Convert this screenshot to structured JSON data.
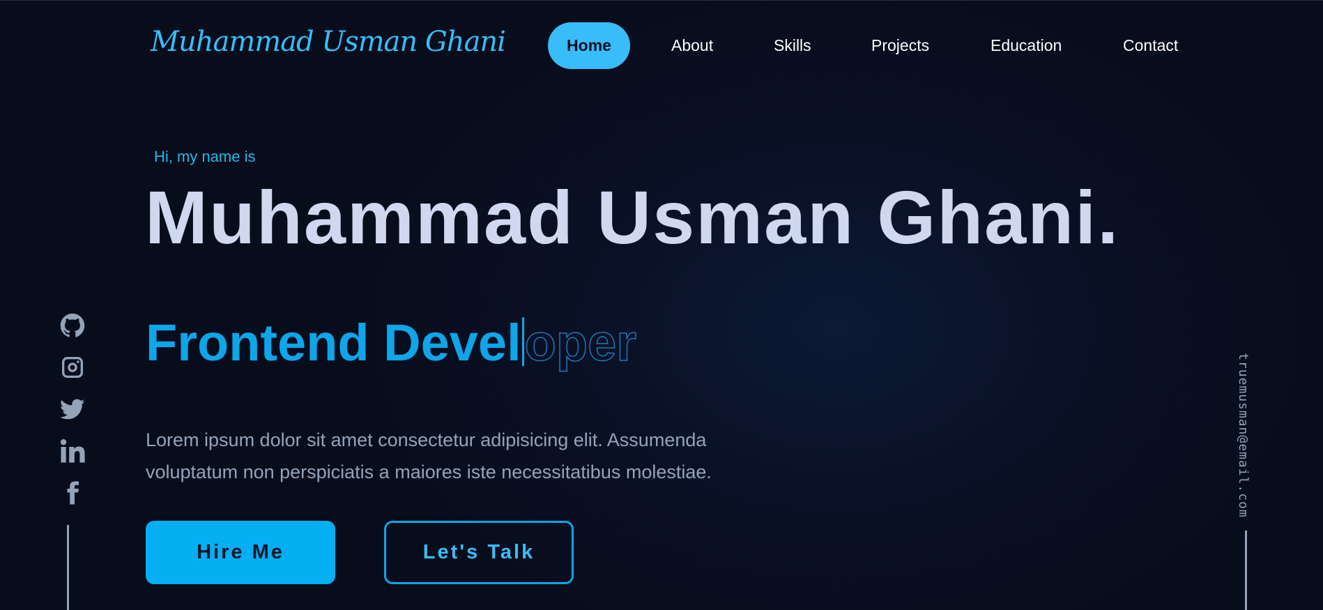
{
  "brand": {
    "logo_text": "Muhammad Usman Ghani"
  },
  "nav": {
    "items": [
      {
        "label": "Home",
        "active": true
      },
      {
        "label": "About",
        "active": false
      },
      {
        "label": "Skills",
        "active": false
      },
      {
        "label": "Projects",
        "active": false
      },
      {
        "label": "Education",
        "active": false
      },
      {
        "label": "Contact",
        "active": false
      }
    ]
  },
  "hero": {
    "greeting": "Hi, my name is",
    "name": "Muhammad Usman Ghani.",
    "role_typed": "Frontend Devel",
    "role_remaining": "oper",
    "description": "Lorem ipsum dolor sit amet consectetur adipisicing elit. Assumenda voluptatum non perspiciatis a maiores iste necessitatibus molestiae.",
    "buttons": {
      "hire": "Hire Me",
      "talk": "Let's Talk"
    }
  },
  "social": {
    "icons": [
      "github-icon",
      "instagram-icon",
      "twitter-icon",
      "linkedin-icon",
      "facebook-icon"
    ]
  },
  "contact": {
    "email": "truemusman@email.com"
  },
  "colors": {
    "accent": "#38bdf8",
    "accent_strong": "#0ea5e9",
    "background": "#090e1e",
    "heading": "#cfd8ee",
    "muted": "#94a3b8"
  }
}
